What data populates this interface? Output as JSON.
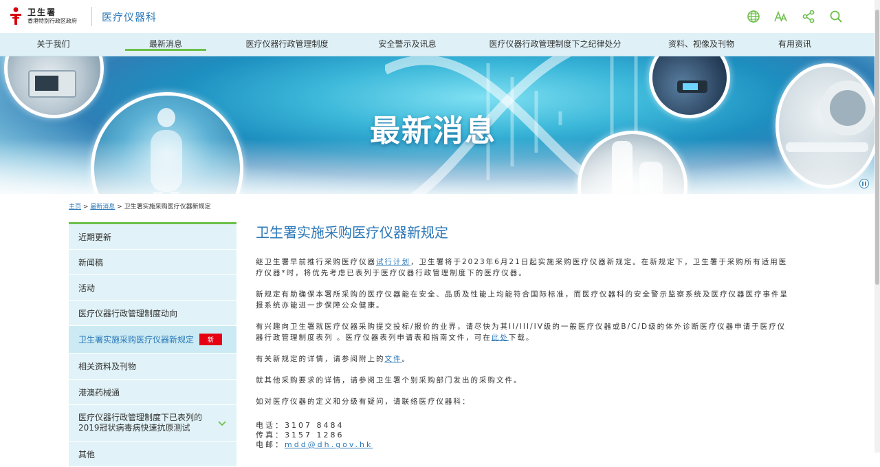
{
  "header": {
    "logo_cn": "卫生署",
    "logo_sub": "香港特别行政区政府",
    "dept_name": "医疗仪器科",
    "icons": [
      "globe-icon",
      "font-size-icon",
      "share-icon",
      "search-icon"
    ]
  },
  "nav": {
    "items": [
      {
        "label": "关于我们"
      },
      {
        "label": "最新消息"
      },
      {
        "label": "医疗仪器行政管理制度"
      },
      {
        "label": "安全警示及讯息"
      },
      {
        "label": "医疗仪器行政管理制度下之纪律处分"
      },
      {
        "label": "资料、视像及刊物"
      },
      {
        "label": "有用资讯"
      }
    ],
    "active_index": 1
  },
  "banner": {
    "title": "最新消息"
  },
  "breadcrumb": {
    "home": "主页",
    "sep1": " > ",
    "news": "最新消息",
    "sep2": " > ",
    "current": "卫生署实施采购医疗仪器新规定"
  },
  "sidebar": {
    "items": [
      {
        "label": "近期更新"
      },
      {
        "label": "新闻稿"
      },
      {
        "label": "活动"
      },
      {
        "label": "医疗仪器行政管理制度动向"
      },
      {
        "label": "卫生署实施采购医疗仪器新规定",
        "badge": "新"
      },
      {
        "label": "相关资料及刊物"
      },
      {
        "label": "港澳药械通"
      },
      {
        "label": "医疗仪器行政管理制度下已表列的2019冠状病毒病快速抗原测试"
      },
      {
        "label": "其他"
      }
    ]
  },
  "content": {
    "title": "卫生署实施采购医疗仪器新规定",
    "p1_a": "继卫生署早前推行采购医疗仪器",
    "p1_link": "试行计划",
    "p1_b": "，卫生署将于2023年6月21日起实施采购医疗仪器新规定。在新规定下，卫生署于采购所有适用医疗仪器*时，将优先考虑已表列于医疗仪器行政管理制度下的医疗仪器。",
    "p2": "新规定有助确保本署所采购的医疗仪器能在安全、品质及性能上均能符合国际标准，而医疗仪器科的安全警示监察系统及医疗仪器医疗事件呈报系统亦能进一步保障公众健康。",
    "p3_a": "有兴趣向卫生署就医疗仪器采购提交投标/报价的业界，请尽快为其II/III/IV级的一般医疗仪器或B/C/D级的体外诊断医疗仪器申请于医疗仪器行政管理制度表列 。医疗仪器表列申请表和指南文件，可在",
    "p3_link": "此处",
    "p3_b": "下载。",
    "p4_a": "有关新规定的详情，请参阅附上的",
    "p4_link": "文件",
    "p4_b": "。",
    "p5": "就其他采购要求的详情，请参阅卫生署个别采购部门发出的采购文件。",
    "p6": "如对医疗仪器的定义和分级有疑问，请联络医疗仪器科：",
    "phone_label": "电话：",
    "phone": "3107 8484",
    "fax_label": "传真：",
    "fax": "3157 1286",
    "email_label": "电邮：",
    "email": "mdd@dh.gov.hk"
  },
  "colors": {
    "brand_blue": "#2b78b8",
    "accent_green": "#6cc04a",
    "nav_bg": "#dff1f7",
    "sidebar_bg": "#e1f3f8",
    "badge_red": "#e60012"
  }
}
